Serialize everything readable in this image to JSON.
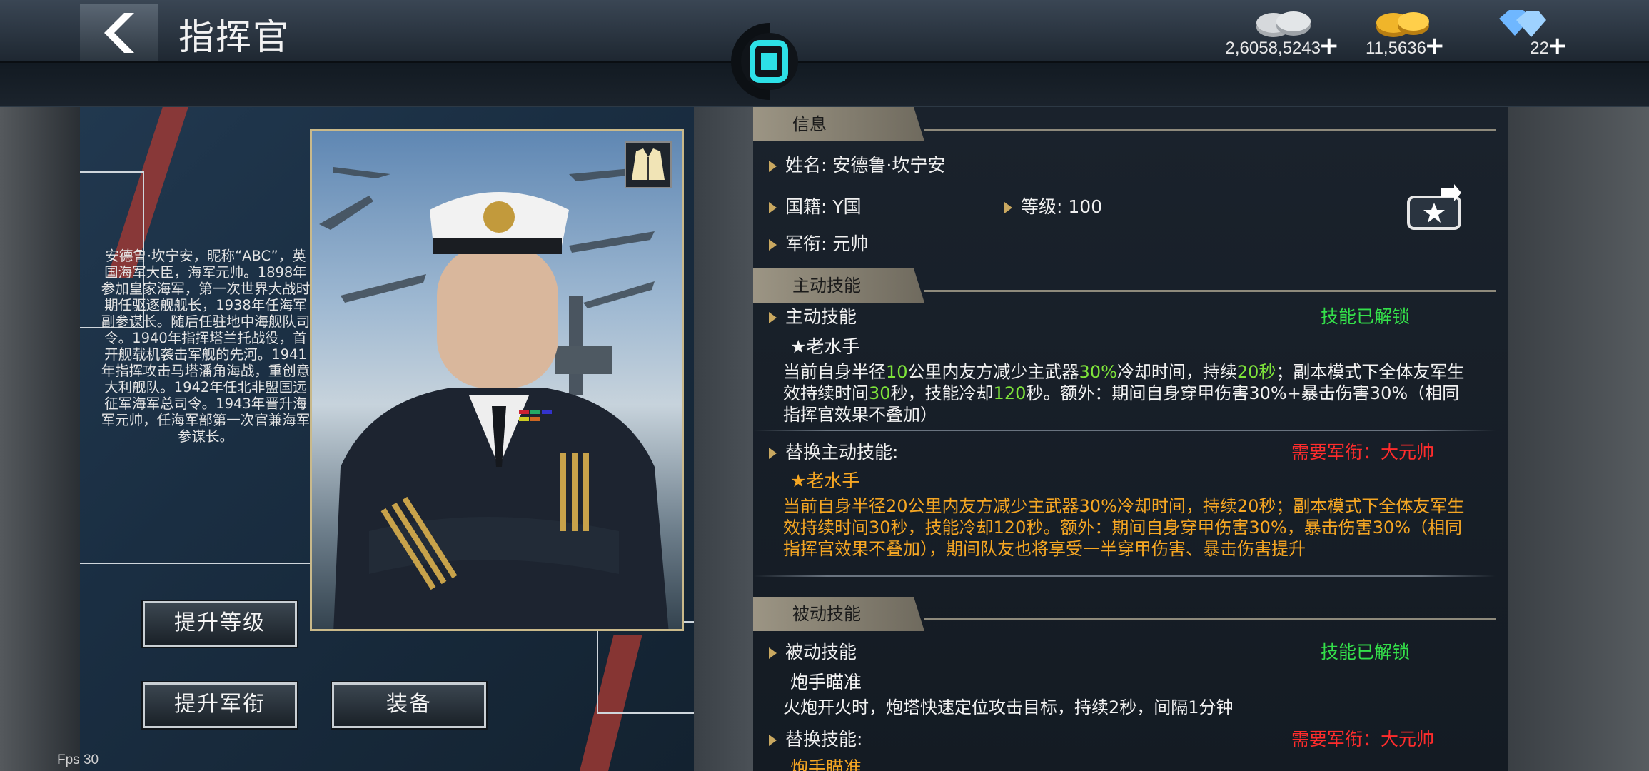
{
  "header": {
    "title": "指挥官",
    "currencies": [
      {
        "icon": "silver-coin-icon",
        "value": "2,6058,5243"
      },
      {
        "icon": "gold-coin-icon",
        "value": "11,5636"
      },
      {
        "icon": "diamond-icon",
        "value": "22"
      }
    ]
  },
  "left": {
    "bio": "安德鲁·坎宁安，昵称“ABC”，英国海军大臣，海军元帅。1898年参加皇家海军，第一次世界大战时期任驱逐舰舰长，1938年任海军副参谋长。随后任驻地中海舰队司令。1940年指挥塔兰托战役，首开舰载机袭击军舰的先河。1941年指挥攻击马塔潘角海战，重创意大利舰队。1942年任北非盟国远征军海军总司令。1943年晋升海军元帅，任海军部第一次官兼海军参谋长。",
    "buttons": {
      "upgrade_level": "提升等级",
      "upgrade_rank": "提升军衔",
      "equip": "装备"
    }
  },
  "info": {
    "section_title": "信息",
    "name_label": "姓名:",
    "name_value": "安德鲁·坎宁安",
    "nation_label": "国籍:",
    "nation_value": "Y国",
    "level_label": "等级:",
    "level_value": "100",
    "rank_label": "军衔:",
    "rank_value": "元帅"
  },
  "active": {
    "section_title": "主动技能",
    "label": "主动技能",
    "status": "技能已解锁",
    "skill_name": "★老水手",
    "desc": [
      {
        "t": "当前自身半径"
      },
      {
        "t": "10",
        "h": true
      },
      {
        "t": "公里内友方减少主武器"
      },
      {
        "t": "30%",
        "h": true
      },
      {
        "t": "冷却时间，持续"
      },
      {
        "t": "20秒",
        "h": true
      },
      {
        "t": "；副本模式下全体友军生效持续时间"
      },
      {
        "t": "30",
        "h": true
      },
      {
        "t": "秒，技能冷却"
      },
      {
        "t": "120",
        "h": true
      },
      {
        "t": "秒。额外：期间自身穿甲伤害30%+暴击伤害30%（相同指挥官效果不叠加）"
      }
    ],
    "alt_label": "替换主动技能:",
    "alt_status": "需要军衔：大元帅",
    "alt_skill_name": "★老水手",
    "alt_desc": "当前自身半径20公里内友方减少主武器30%冷却时间，持续20秒；副本模式下全体友军生效持续时间30秒，技能冷却120秒。额外：期间自身穿甲伤害30%，暴击伤害30%（相同指挥官效果不叠加），期间队友也将享受一半穿甲伤害、暴击伤害提升"
  },
  "passive": {
    "section_title": "被动技能",
    "label": "被动技能",
    "status": "技能已解锁",
    "skill_name": "炮手瞄准",
    "desc": "火炮开火时，炮塔快速定位攻击目标，持续2秒，间隔1分钟",
    "alt_label": "替换技能:",
    "alt_status": "需要军衔：大元帅",
    "alt_skill_name": "炮手瞄准"
  },
  "fps": "Fps 30",
  "colors": {
    "green_status": "#34e04a",
    "red_status": "#ff2c2c",
    "orange_text": "#f5a623",
    "highlight": "#7ee33a"
  }
}
